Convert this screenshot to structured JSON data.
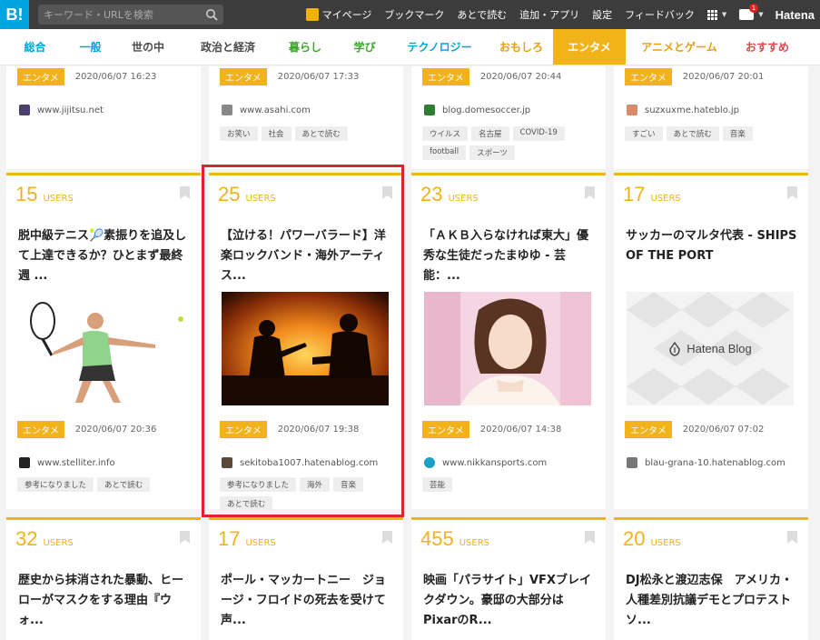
{
  "header": {
    "logo": "B!",
    "search_placeholder": "キーワード・URLを検索",
    "nav": {
      "mypage": "マイページ",
      "bookmark": "ブックマーク",
      "read_later": "あとで読む",
      "add_app": "追加・アプリ",
      "settings": "設定",
      "feedback": "フィードバック",
      "notifications_count": "1",
      "brand": "Hatena"
    }
  },
  "categories": [
    {
      "label": "総合",
      "color": "#00a4de"
    },
    {
      "label": "一般",
      "color": "#00a4de"
    },
    {
      "label": "世の中",
      "color": "#4b4b4b"
    },
    {
      "label": "政治と経済",
      "color": "#4b4b4b"
    },
    {
      "label": "暮らし",
      "color": "#3ca42c"
    },
    {
      "label": "学び",
      "color": "#3ca42c"
    },
    {
      "label": "テクノロジー",
      "color": "#00a4de"
    },
    {
      "label": "おもしろ",
      "color": "#e6a012"
    },
    {
      "label": "エンタメ",
      "color": "#ffffff"
    },
    {
      "label": "アニメとゲーム",
      "color": "#e6a012"
    },
    {
      "label": "おすすめ",
      "color": "#e0454b"
    }
  ],
  "rows": {
    "top": [
      {
        "category": "エンタメ",
        "date": "2020/06/07 16:23",
        "site": "www.jijitsu.net",
        "tags": []
      },
      {
        "category": "エンタメ",
        "date": "2020/06/07 17:33",
        "site": "www.asahi.com",
        "tags": [
          "お笑い",
          "社会",
          "あとで読む"
        ]
      },
      {
        "category": "エンタメ",
        "date": "2020/06/07 20:44",
        "site": "blog.domesoccer.jp",
        "tags": [
          "ウイルス",
          "名古屋",
          "COVID-19",
          "football",
          "スポーツ"
        ]
      },
      {
        "category": "エンタメ",
        "date": "2020/06/07 20:01",
        "site": "suzxuxme.hateblo.jp",
        "tags": [
          "すごい",
          "あとで読む",
          "音楽"
        ]
      }
    ],
    "mid": [
      {
        "users": "15",
        "users_label": "USERS",
        "title": "脱中級テニス🎾素振りを追及して上達できるか？ひとまず最終週 ...",
        "category": "エンタメ",
        "date": "2020/06/07 20:36",
        "site": "www.stelliter.info",
        "tags": [
          "参考になりました",
          "あとで読む"
        ]
      },
      {
        "users": "25",
        "users_label": "USERS",
        "title": "【泣ける！パワーバラード】洋楽ロックバンド・海外アーティス...",
        "category": "エンタメ",
        "date": "2020/06/07 19:38",
        "site": "sekitoba1007.hatenablog.com",
        "tags": [
          "参考になりました",
          "海外",
          "音楽",
          "あとで読む"
        ]
      },
      {
        "users": "23",
        "users_label": "USERS",
        "title": "「ＡＫＢ入らなければ東大」優秀な生徒だったまゆゆ - 芸能：...",
        "category": "エンタメ",
        "date": "2020/06/07 14:38",
        "site": "www.nikkansports.com",
        "tags": [
          "芸能"
        ]
      },
      {
        "users": "17",
        "users_label": "USERS",
        "title": "サッカーのマルタ代表 - SHIPS OF THE PORT",
        "thumb_text": "Hatena Blog",
        "category": "エンタメ",
        "date": "2020/06/07 07:02",
        "site": "blau-grana-10.hatenablog.com",
        "tags": []
      }
    ],
    "bottom": [
      {
        "users": "32",
        "users_label": "USERS",
        "title": "歴史から抹消された暴動、ヒーローがマスクをする理由『ウォ..."
      },
      {
        "users": "17",
        "users_label": "USERS",
        "title": "ポール・マッカートニー　ジョージ・フロイドの死去を受けて声..."
      },
      {
        "users": "455",
        "users_label": "USERS",
        "title": "映画「パラサイト」VFXブレイクダウン。豪邸の大部分はPixarのR..."
      },
      {
        "users": "20",
        "users_label": "USERS",
        "title": "DJ松永と渡辺志保　アメリカ・人種差別抗議デモとプロテストソ..."
      }
    ]
  }
}
